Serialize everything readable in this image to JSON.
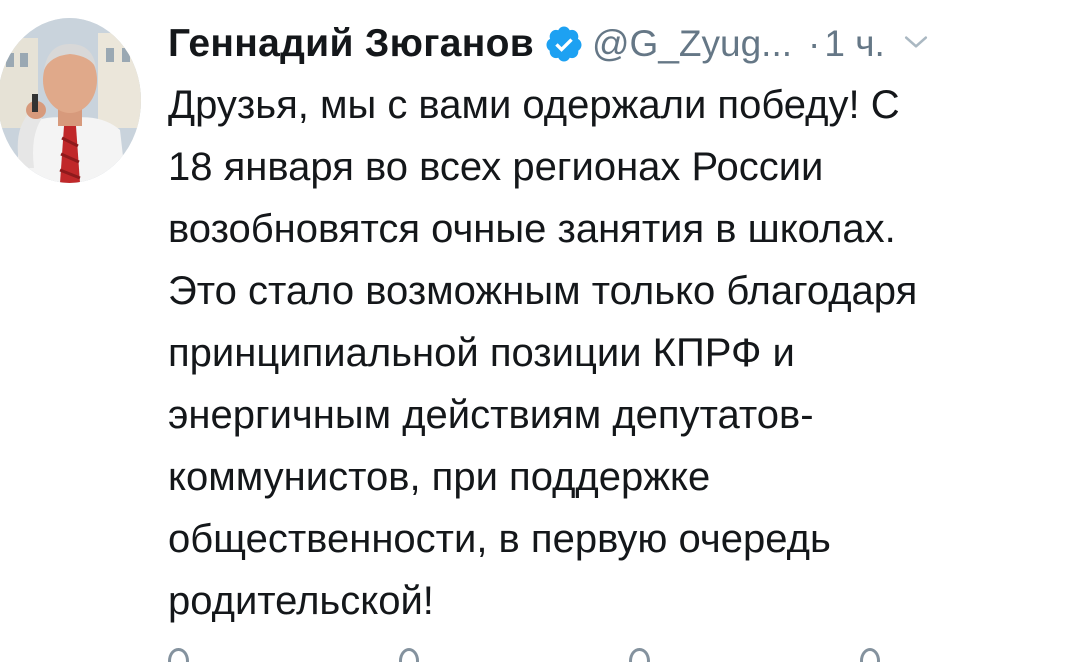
{
  "author": {
    "display_name": "Геннадий Зюганов",
    "handle": "@G_Zyug...",
    "verified": true,
    "dot": "·",
    "time": "1 ч."
  },
  "tweet": {
    "lines": [
      "Друзья, мы с вами одержали победу! С",
      "18 января во всех регионах России",
      "возобновятся очные занятия в школах.",
      "Это стало возможным только благодаря",
      "принципиальной позиции КПРФ и",
      "энергичным действиям депутатов-",
      "коммунистов, при поддержке",
      "общественности, в первую очередь",
      "родительской!"
    ]
  },
  "icons": {
    "verified": "verified-badge-icon",
    "more": "chevron-down-icon",
    "reply": "reply-icon",
    "retweet": "retweet-icon",
    "like": "like-icon",
    "share": "share-icon"
  },
  "colors": {
    "verified_blue": "#1da1f2",
    "secondary_text": "#657786",
    "primary_text": "#14171a"
  }
}
